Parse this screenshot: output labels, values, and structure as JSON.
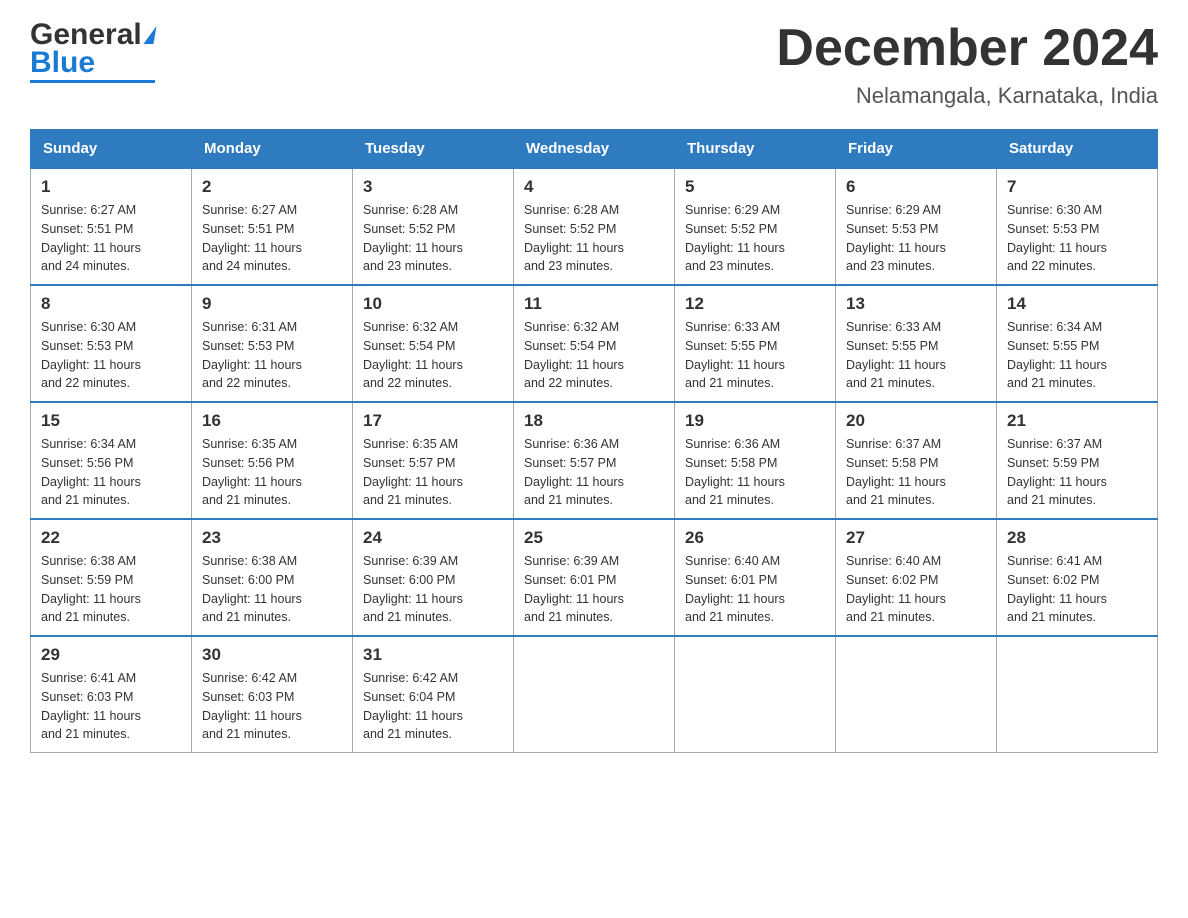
{
  "header": {
    "logo_general": "General",
    "logo_blue": "Blue",
    "main_title": "December 2024",
    "subtitle": "Nelamangala, Karnataka, India"
  },
  "calendar": {
    "days_of_week": [
      "Sunday",
      "Monday",
      "Tuesday",
      "Wednesday",
      "Thursday",
      "Friday",
      "Saturday"
    ],
    "weeks": [
      [
        {
          "day": "1",
          "sunrise": "6:27 AM",
          "sunset": "5:51 PM",
          "daylight": "11 hours and 24 minutes."
        },
        {
          "day": "2",
          "sunrise": "6:27 AM",
          "sunset": "5:51 PM",
          "daylight": "11 hours and 24 minutes."
        },
        {
          "day": "3",
          "sunrise": "6:28 AM",
          "sunset": "5:52 PM",
          "daylight": "11 hours and 23 minutes."
        },
        {
          "day": "4",
          "sunrise": "6:28 AM",
          "sunset": "5:52 PM",
          "daylight": "11 hours and 23 minutes."
        },
        {
          "day": "5",
          "sunrise": "6:29 AM",
          "sunset": "5:52 PM",
          "daylight": "11 hours and 23 minutes."
        },
        {
          "day": "6",
          "sunrise": "6:29 AM",
          "sunset": "5:53 PM",
          "daylight": "11 hours and 23 minutes."
        },
        {
          "day": "7",
          "sunrise": "6:30 AM",
          "sunset": "5:53 PM",
          "daylight": "11 hours and 22 minutes."
        }
      ],
      [
        {
          "day": "8",
          "sunrise": "6:30 AM",
          "sunset": "5:53 PM",
          "daylight": "11 hours and 22 minutes."
        },
        {
          "day": "9",
          "sunrise": "6:31 AM",
          "sunset": "5:53 PM",
          "daylight": "11 hours and 22 minutes."
        },
        {
          "day": "10",
          "sunrise": "6:32 AM",
          "sunset": "5:54 PM",
          "daylight": "11 hours and 22 minutes."
        },
        {
          "day": "11",
          "sunrise": "6:32 AM",
          "sunset": "5:54 PM",
          "daylight": "11 hours and 22 minutes."
        },
        {
          "day": "12",
          "sunrise": "6:33 AM",
          "sunset": "5:55 PM",
          "daylight": "11 hours and 21 minutes."
        },
        {
          "day": "13",
          "sunrise": "6:33 AM",
          "sunset": "5:55 PM",
          "daylight": "11 hours and 21 minutes."
        },
        {
          "day": "14",
          "sunrise": "6:34 AM",
          "sunset": "5:55 PM",
          "daylight": "11 hours and 21 minutes."
        }
      ],
      [
        {
          "day": "15",
          "sunrise": "6:34 AM",
          "sunset": "5:56 PM",
          "daylight": "11 hours and 21 minutes."
        },
        {
          "day": "16",
          "sunrise": "6:35 AM",
          "sunset": "5:56 PM",
          "daylight": "11 hours and 21 minutes."
        },
        {
          "day": "17",
          "sunrise": "6:35 AM",
          "sunset": "5:57 PM",
          "daylight": "11 hours and 21 minutes."
        },
        {
          "day": "18",
          "sunrise": "6:36 AM",
          "sunset": "5:57 PM",
          "daylight": "11 hours and 21 minutes."
        },
        {
          "day": "19",
          "sunrise": "6:36 AM",
          "sunset": "5:58 PM",
          "daylight": "11 hours and 21 minutes."
        },
        {
          "day": "20",
          "sunrise": "6:37 AM",
          "sunset": "5:58 PM",
          "daylight": "11 hours and 21 minutes."
        },
        {
          "day": "21",
          "sunrise": "6:37 AM",
          "sunset": "5:59 PM",
          "daylight": "11 hours and 21 minutes."
        }
      ],
      [
        {
          "day": "22",
          "sunrise": "6:38 AM",
          "sunset": "5:59 PM",
          "daylight": "11 hours and 21 minutes."
        },
        {
          "day": "23",
          "sunrise": "6:38 AM",
          "sunset": "6:00 PM",
          "daylight": "11 hours and 21 minutes."
        },
        {
          "day": "24",
          "sunrise": "6:39 AM",
          "sunset": "6:00 PM",
          "daylight": "11 hours and 21 minutes."
        },
        {
          "day": "25",
          "sunrise": "6:39 AM",
          "sunset": "6:01 PM",
          "daylight": "11 hours and 21 minutes."
        },
        {
          "day": "26",
          "sunrise": "6:40 AM",
          "sunset": "6:01 PM",
          "daylight": "11 hours and 21 minutes."
        },
        {
          "day": "27",
          "sunrise": "6:40 AM",
          "sunset": "6:02 PM",
          "daylight": "11 hours and 21 minutes."
        },
        {
          "day": "28",
          "sunrise": "6:41 AM",
          "sunset": "6:02 PM",
          "daylight": "11 hours and 21 minutes."
        }
      ],
      [
        {
          "day": "29",
          "sunrise": "6:41 AM",
          "sunset": "6:03 PM",
          "daylight": "11 hours and 21 minutes."
        },
        {
          "day": "30",
          "sunrise": "6:42 AM",
          "sunset": "6:03 PM",
          "daylight": "11 hours and 21 minutes."
        },
        {
          "day": "31",
          "sunrise": "6:42 AM",
          "sunset": "6:04 PM",
          "daylight": "11 hours and 21 minutes."
        },
        null,
        null,
        null,
        null
      ]
    ],
    "labels": {
      "sunrise": "Sunrise:",
      "sunset": "Sunset:",
      "daylight": "Daylight:"
    }
  }
}
